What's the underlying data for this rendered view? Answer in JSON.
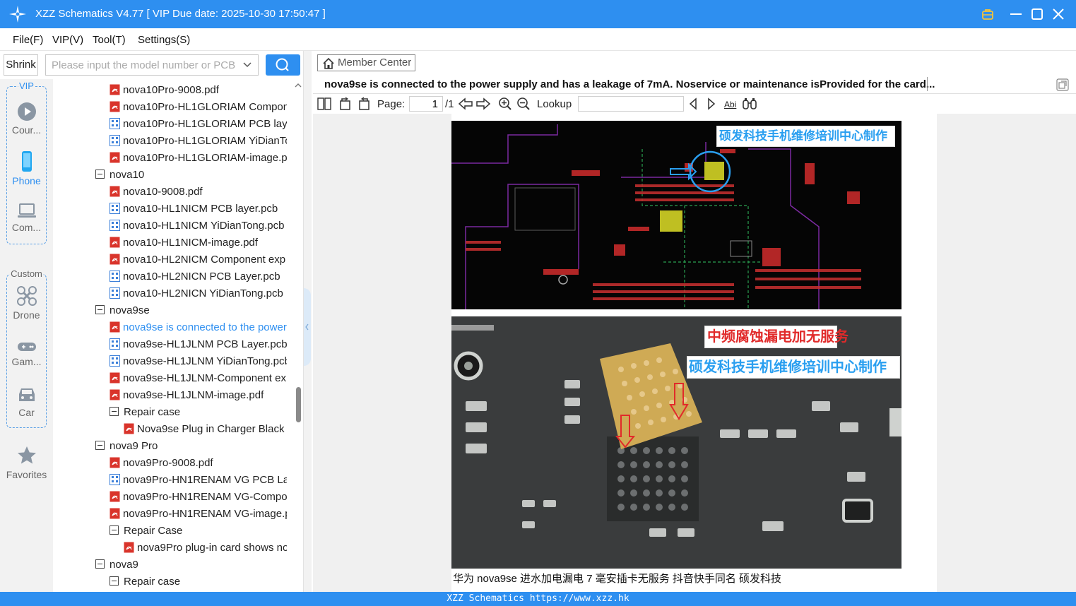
{
  "app": {
    "title": "XZZ Schematics V4.77 [ VIP Due date: 2025-10-30 17:50:47 ]"
  },
  "menu": [
    "File(F)",
    "VIP(V)",
    "Tool(T)",
    "Settings(S)"
  ],
  "search": {
    "shrink_label": "Shrink",
    "placeholder": "Please input the model number or PCB"
  },
  "rail": {
    "vip_label": "VIP",
    "custom_label": "Custom",
    "items": [
      {
        "label": "Cour...",
        "icon": "play-icon"
      },
      {
        "label": "Phone",
        "icon": "phone-icon"
      },
      {
        "label": "Com...",
        "icon": "laptop-icon"
      },
      {
        "label": "Drone",
        "icon": "drone-icon"
      },
      {
        "label": "Gam...",
        "icon": "gamepad-icon"
      },
      {
        "label": "Car",
        "icon": "car-icon"
      },
      {
        "label": "Favorites",
        "icon": "star-icon"
      }
    ]
  },
  "tree": [
    {
      "label": "nova10Pro-9008.pdf",
      "type": "pdf",
      "indent": 2
    },
    {
      "label": "nova10Pro-HL1GLORIAM Component",
      "type": "pdf",
      "indent": 2
    },
    {
      "label": "nova10Pro-HL1GLORIAM PCB layer",
      "type": "pcb",
      "indent": 2
    },
    {
      "label": "nova10Pro-HL1GLORIAM YiDianTong",
      "type": "pcb",
      "indent": 2
    },
    {
      "label": "nova10Pro-HL1GLORIAM-image.pdf",
      "type": "pdf",
      "indent": 2
    },
    {
      "label": "nova10",
      "type": "folder",
      "indent": 1
    },
    {
      "label": "nova10-9008.pdf",
      "type": "pdf",
      "indent": 2
    },
    {
      "label": "nova10-HL1NICM PCB layer.pcb",
      "type": "pcb",
      "indent": 2
    },
    {
      "label": "nova10-HL1NICM YiDianTong.pcb",
      "type": "pcb",
      "indent": 2
    },
    {
      "label": "nova10-HL1NICM-image.pdf",
      "type": "pdf",
      "indent": 2
    },
    {
      "label": "nova10-HL2NICM Component exp",
      "type": "pdf",
      "indent": 2
    },
    {
      "label": "nova10-HL2NICN PCB Layer.pcb",
      "type": "pcb",
      "indent": 2
    },
    {
      "label": "nova10-HL2NICN YiDianTong.pcb",
      "type": "pcb",
      "indent": 2
    },
    {
      "label": "nova9se",
      "type": "folder",
      "indent": 1
    },
    {
      "label": "nova9se is connected to the power",
      "type": "pdf",
      "indent": 2,
      "selected": true
    },
    {
      "label": "nova9se-HL1JLNM PCB Layer.pcb",
      "type": "pcb",
      "indent": 2
    },
    {
      "label": "nova9se-HL1JLNM YiDianTong.pcb",
      "type": "pcb",
      "indent": 2
    },
    {
      "label": "nova9se-HL1JLNM-Component ex",
      "type": "pdf",
      "indent": 2
    },
    {
      "label": "nova9se-HL1JLNM-image.pdf",
      "type": "pdf",
      "indent": 2
    },
    {
      "label": "Repair case",
      "type": "folder",
      "indent": 2
    },
    {
      "label": "Nova9se Plug in Charger Black",
      "type": "pdf",
      "indent": 3
    },
    {
      "label": "nova9 Pro",
      "type": "folder",
      "indent": 1
    },
    {
      "label": "nova9Pro-9008.pdf",
      "type": "pdf",
      "indent": 2
    },
    {
      "label": "nova9Pro-HN1RENAM VG PCB Lay",
      "type": "pcb",
      "indent": 2
    },
    {
      "label": "nova9Pro-HN1RENAM VG-Compo",
      "type": "pdf",
      "indent": 2
    },
    {
      "label": "nova9Pro-HN1RENAM VG-image.p",
      "type": "pdf",
      "indent": 2
    },
    {
      "label": "Repair Case",
      "type": "folder",
      "indent": 2
    },
    {
      "label": "nova9Pro plug-in card shows no",
      "type": "pdf",
      "indent": 3
    },
    {
      "label": "nova9",
      "type": "folder",
      "indent": 1
    },
    {
      "label": "Repair case",
      "type": "folder",
      "indent": 2
    }
  ],
  "viewer": {
    "member_center": "Member Center",
    "doc_title": "nova9se is connected to the power supply and has a leakage of 7mA. Noservice or maintenance isProvided for the card...",
    "page_label": "Page:",
    "page_value": "1",
    "page_total": "/1",
    "lookup_label": "Lookup",
    "abi_label": "Abi",
    "img1_overlay": "硕发科技手机维修培训中心制作",
    "img2_overlay_red": "中频腐蚀漏电加无服务",
    "img2_overlay_blue": "硕发科技手机维修培训中心制作",
    "caption": "华为 nova9se 进水加电漏电 7 毫安插卡无服务   抖音快手同名   硕发科技"
  },
  "statusbar": "XZZ Schematics https://www.xzz.hk",
  "colors": {
    "accent": "#2e8ff0",
    "pdf_icon": "#d9342b",
    "pcb_icon": "#3b7fd9"
  }
}
